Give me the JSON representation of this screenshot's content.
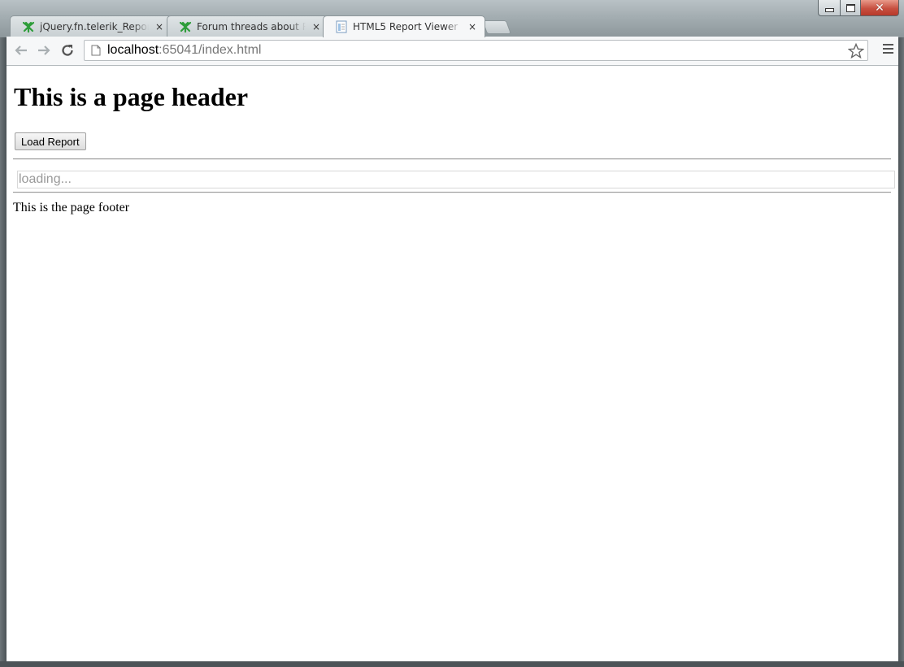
{
  "browser": {
    "tabs": [
      {
        "title": "jQuery.fn.telerik_ReportViewer",
        "icon": "telerik-icon",
        "active": false
      },
      {
        "title": "Forum threads about Reporting",
        "icon": "telerik-icon",
        "active": false
      },
      {
        "title": "HTML5 Report Viewer",
        "icon": "page-icon",
        "active": true
      }
    ],
    "tab_close_glyph": "×",
    "address": {
      "host": "localhost",
      "rest": ":65041/index.html"
    }
  },
  "page": {
    "header": "This is a page header",
    "load_button": "Load Report",
    "viewer_status": "loading...",
    "footer": "This is the page footer"
  },
  "colors": {
    "telerik_green": "#2e9d3a",
    "close_red": "#c75040"
  }
}
